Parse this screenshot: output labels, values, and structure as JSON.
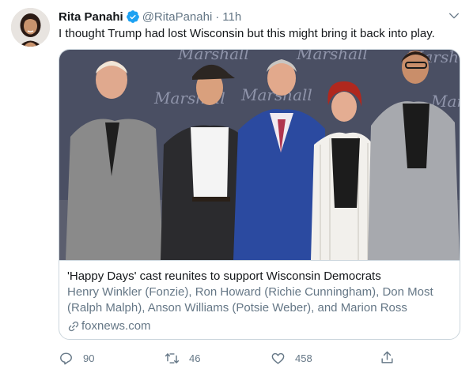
{
  "tweet": {
    "author": {
      "display_name": "Rita Panahi",
      "handle": "@RitaPanahi",
      "verified": true
    },
    "separator": "·",
    "timestamp": "11h",
    "text": "I thought Trump had lost Wisconsin but this might bring it back into play."
  },
  "card": {
    "image_description_icon": "photo",
    "backdrop_text": "Marshall",
    "title": "'Happy Days' cast reunites to support Wisconsin Democrats",
    "description": "Henry Winkler (Fonzie), Ron Howard (Richie Cunningham), Don Most (Ralph Malph), Anson Williams (Potsie Weber), and Marion Ross (Marion…",
    "domain": "foxnews.com"
  },
  "actions": {
    "reply_count": "90",
    "retweet_count": "46",
    "like_count": "458"
  },
  "colors": {
    "verified_blue": "#1da1f2",
    "muted_text": "#657786",
    "border": "#ccd6dd"
  }
}
